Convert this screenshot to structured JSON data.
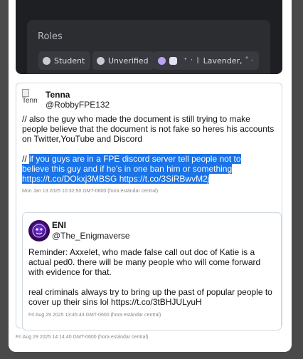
{
  "discord": {
    "roles_title": "Roles",
    "roles": [
      {
        "label": "Student",
        "color": "#c8ccd2"
      },
      {
        "label": "Unverified",
        "color": "#c8ccd2"
      },
      {
        "label": "Lavender,",
        "color": "#b9a3f0",
        "extra_prefix": "・",
        "decor": "⁺˚ · ✧ ·"
      }
    ]
  },
  "tweet1": {
    "avatar_alt": "Tenn",
    "name": "Tenna",
    "handle": "@RobbyFPE132",
    "para1": "// also the guy who made the document is still trying to make people believe that the document is not fake so heres his accounts on Twitter,YouTube and Discord",
    "para2_plain": "// ",
    "para2_highlight_line1": "if you guys are in a FPE discord server tell people not to",
    "para2_highlight_line2": "believe this guy and if he's in one ban him or something",
    "para2_highlight_line3": "https://t.co/DOkxj3MBSG https://t.co/3SiRBwvM2j",
    "date": "Mon Jan 13 2025 10:32:50 GMT-0600 (hora estándar central)"
  },
  "tweet2": {
    "name": "ENI",
    "handle": "@The_Enigmaverse",
    "para1": "Reminder: Axxelet, who made false call out doc of Katie is a actual ped0. there will be many people who will come forward with evidence for that.",
    "para2": "real criminals always try to bring up the past of popular people to cover up their sins lol https://t.co/3tBHJULyuH",
    "date": "Fri Aug 29 2025 13:45:43 GMT-0600 (hora estándar central)"
  },
  "outer_date": "Fri Aug 29 2025 14:14:40 GMT-0600 (hora estándar central)",
  "colors": {
    "discord_bg": "#1e1f22",
    "roles_bg": "#2b2d31",
    "highlight": "#1a73e8"
  }
}
